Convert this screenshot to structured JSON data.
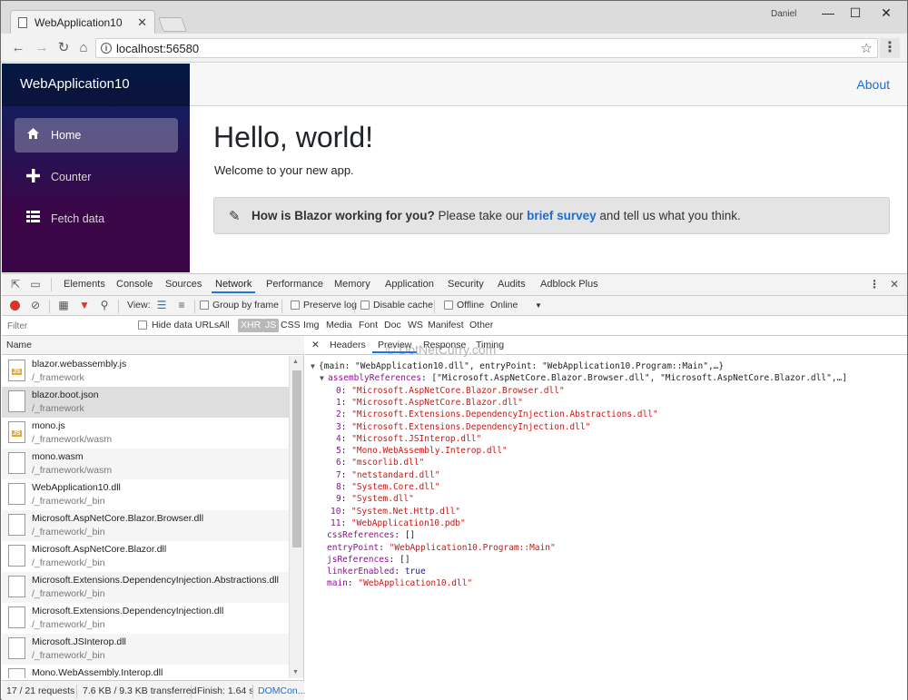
{
  "browser": {
    "tab_title": "WebApplication10",
    "tab_close": "✕",
    "user": "Daniel",
    "url": "localhost:56580"
  },
  "app": {
    "brand": "WebApplication10",
    "nav": [
      {
        "label": "Home",
        "icon": "home-icon"
      },
      {
        "label": "Counter",
        "icon": "plus-icon"
      },
      {
        "label": "Fetch data",
        "icon": "list-icon"
      }
    ],
    "about": "About",
    "heading": "Hello, world!",
    "welcome": "Welcome to your new app.",
    "survey": {
      "question": "How is Blazor working for you?",
      "before": " Please take our ",
      "link": "brief survey",
      "after": " and tell us what you think."
    }
  },
  "devtools": {
    "tabs": [
      "Elements",
      "Console",
      "Sources",
      "Network",
      "Performance",
      "Memory",
      "Application",
      "Security",
      "Audits",
      "Adblock Plus"
    ],
    "active_tab": "Network",
    "toolbar": {
      "view_label": "View:",
      "group_by_frame": "Group by frame",
      "preserve_log": "Preserve log",
      "disable_cache": "Disable cache",
      "offline": "Offline",
      "throttle": "Online"
    },
    "filter": {
      "placeholder": "Filter",
      "hide_data_urls": "Hide data URLs",
      "types": [
        "All",
        "XHR",
        "JS",
        "CSS",
        "Img",
        "Media",
        "Font",
        "Doc",
        "WS",
        "Manifest",
        "Other"
      ]
    },
    "column_name": "Name",
    "files": [
      {
        "name": "blazor.webassembly.js",
        "path": "/_framework",
        "type": "js"
      },
      {
        "name": "blazor.boot.json",
        "path": "/_framework",
        "type": "doc"
      },
      {
        "name": "mono.js",
        "path": "/_framework/wasm",
        "type": "js"
      },
      {
        "name": "mono.wasm",
        "path": "/_framework/wasm",
        "type": "doc"
      },
      {
        "name": "WebApplication10.dll",
        "path": "/_framework/_bin",
        "type": "doc"
      },
      {
        "name": "Microsoft.AspNetCore.Blazor.Browser.dll",
        "path": "/_framework/_bin",
        "type": "doc"
      },
      {
        "name": "Microsoft.AspNetCore.Blazor.dll",
        "path": "/_framework/_bin",
        "type": "doc"
      },
      {
        "name": "Microsoft.Extensions.DependencyInjection.Abstractions.dll",
        "path": "/_framework/_bin",
        "type": "doc"
      },
      {
        "name": "Microsoft.Extensions.DependencyInjection.dll",
        "path": "/_framework/_bin",
        "type": "doc"
      },
      {
        "name": "Microsoft.JSInterop.dll",
        "path": "/_framework/_bin",
        "type": "doc"
      },
      {
        "name": "Mono.WebAssembly.Interop.dll",
        "path": "",
        "type": "doc"
      }
    ],
    "selected_file_index": 1,
    "status": {
      "requests": "17 / 21 requests",
      "transferred": "7.6 KB / 9.3 KB transferred",
      "finish": "Finish: 1.64 s",
      "dom": "DOMCon..."
    },
    "preview_tabs": [
      "Headers",
      "Preview",
      "Response",
      "Timing"
    ],
    "preview_active": "Preview",
    "watermark": "© DotNetCurry.com",
    "json": {
      "summary": "{main: \"WebApplication10.dll\", entryPoint: \"WebApplication10.Program::Main\",…}",
      "assembly_key": "assemblyReferences",
      "assembly_summary": "[\"Microsoft.AspNetCore.Blazor.Browser.dll\", \"Microsoft.AspNetCore.Blazor.dll\",…]",
      "assemblies": [
        "\"Microsoft.AspNetCore.Blazor.Browser.dll\"",
        "\"Microsoft.AspNetCore.Blazor.dll\"",
        "\"Microsoft.Extensions.DependencyInjection.Abstractions.dll\"",
        "\"Microsoft.Extensions.DependencyInjection.dll\"",
        "\"Microsoft.JSInterop.dll\"",
        "\"Mono.WebAssembly.Interop.dll\"",
        "\"mscorlib.dll\"",
        "\"netstandard.dll\"",
        "\"System.Core.dll\"",
        "\"System.dll\"",
        "\"System.Net.Http.dll\"",
        "\"WebApplication10.pdb\""
      ],
      "rest": [
        {
          "key": "cssReferences",
          "value": "[]",
          "kind": "plain"
        },
        {
          "key": "entryPoint",
          "value": "\"WebApplication10.Program::Main\"",
          "kind": "str"
        },
        {
          "key": "jsReferences",
          "value": "[]",
          "kind": "plain"
        },
        {
          "key": "linkerEnabled",
          "value": "true",
          "kind": "kw"
        },
        {
          "key": "main",
          "value": "\"WebApplication10.dll\"",
          "kind": "str"
        }
      ]
    }
  },
  "colors": {
    "sidebar_top": "#052767",
    "sidebar_bottom": "#3a0647",
    "link": "#1a6ed8",
    "record": "#e0312f"
  }
}
